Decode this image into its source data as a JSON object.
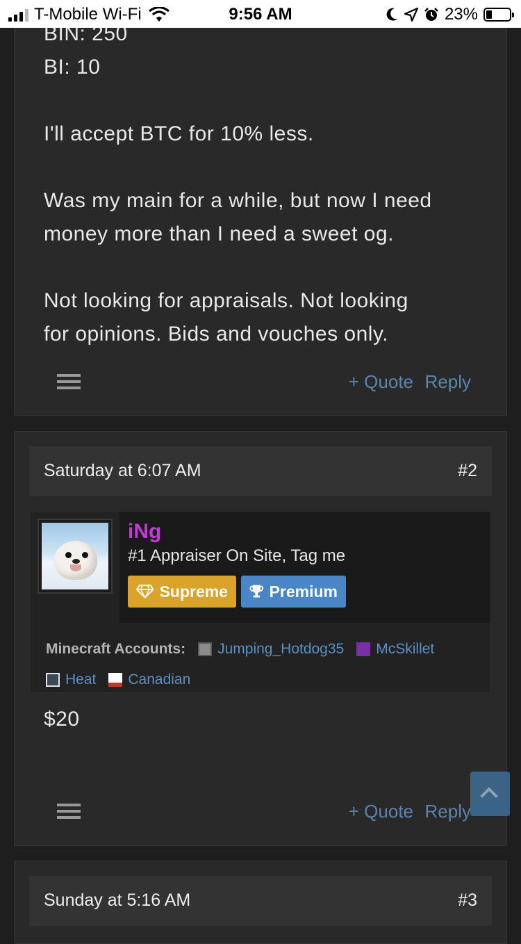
{
  "status_bar": {
    "carrier": "T-Mobile Wi-Fi",
    "time": "9:56 AM",
    "battery": "23%",
    "icons": [
      "wifi-icon",
      "moon-icon",
      "location-icon",
      "alarm-icon",
      "battery-icon"
    ]
  },
  "post1": {
    "lines": [
      "BIN: 250",
      "BI: 10",
      "",
      "I'll accept BTC for 10% less.",
      "",
      "Was my main for a while, but now I need",
      "money more than I need a sweet og.",
      "",
      "Not looking for appraisals. Not looking",
      "for opinions. Bids and vouches only."
    ],
    "quote_label": "+ Quote",
    "reply_label": "Reply"
  },
  "post2": {
    "date": "Saturday at 6:07 AM",
    "number": "#2",
    "user": {
      "name": "iNg",
      "name_color": "#c33bd6",
      "title": "#1 Appraiser On Site, Tag me",
      "badges": [
        {
          "label": "Supreme",
          "icon": "diamond-icon",
          "color": "#d9a429"
        },
        {
          "label": "Premium",
          "icon": "trophy-icon",
          "color": "#4a86c5"
        }
      ]
    },
    "minecraft_label": "Minecraft Accounts:",
    "minecraft_accounts": [
      "Jumping_Hotdog35",
      "McSkillet",
      "Heat",
      "Canadian"
    ],
    "body": "$20",
    "quote_label": "+ Quote",
    "reply_label": "Reply"
  },
  "post3": {
    "date": "Sunday at 5:16 AM",
    "number": "#3"
  },
  "colors": {
    "link": "#5b84ae",
    "background": "#1e1e1e",
    "card": "#292929"
  }
}
